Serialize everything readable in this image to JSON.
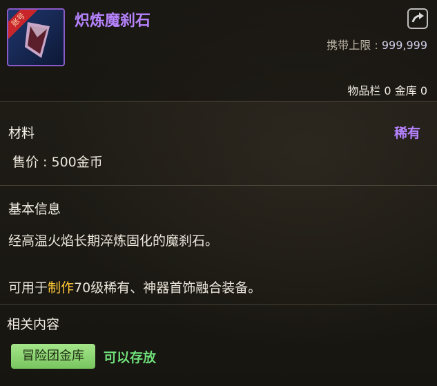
{
  "item": {
    "name": "炽炼魔刹石",
    "icon_tag": "账号",
    "icon": "red-crystal-gem-icon",
    "carry_limit_label": "携带上限 : ",
    "carry_limit_value": "999,999",
    "inventory_label": "物品栏",
    "inventory_count": "0",
    "vault_label": "金库",
    "vault_count": "0"
  },
  "info": {
    "type": "材料",
    "rarity": "稀有",
    "price": "售价 : 500金币",
    "basic_title": "基本信息",
    "description": "经高温火焰长期淬炼固化的魔刹石。",
    "usage_prefix": "可用于",
    "usage_highlight": "制作",
    "usage_suffix": "70级稀有、神器首饰融合装备。",
    "related_title": "相关内容",
    "storage_badge": "冒险团金库",
    "storage_note": "可以存放"
  },
  "colors": {
    "rarity": "#b683ff",
    "highlight": "#ffc93a",
    "badge": "#8fd676"
  }
}
